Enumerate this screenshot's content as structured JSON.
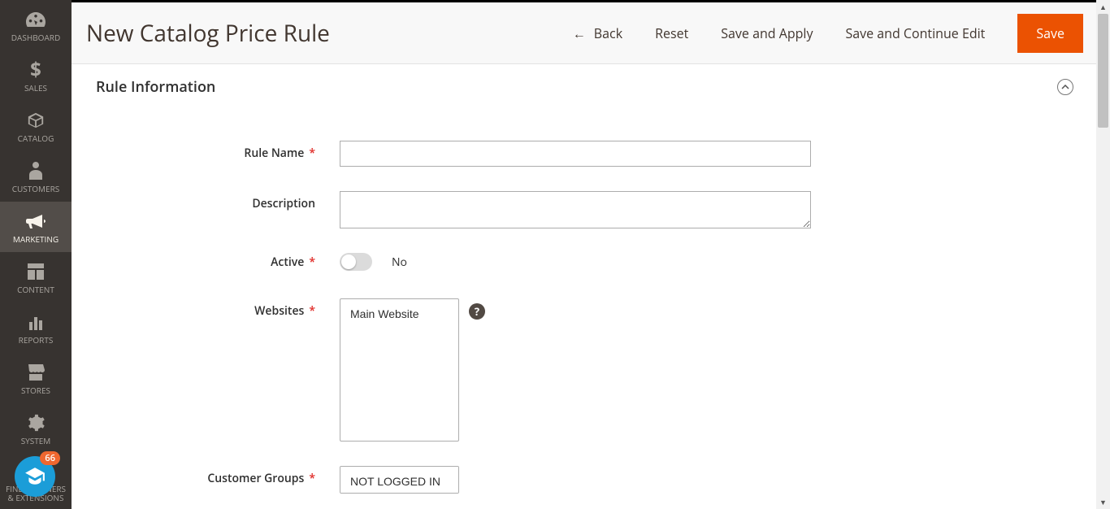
{
  "sidebar": {
    "items": [
      {
        "label": "DASHBOARD"
      },
      {
        "label": "SALES"
      },
      {
        "label": "CATALOG"
      },
      {
        "label": "CUSTOMERS"
      },
      {
        "label": "MARKETING"
      },
      {
        "label": "CONTENT"
      },
      {
        "label": "REPORTS"
      },
      {
        "label": "STORES"
      },
      {
        "label": "SYSTEM"
      },
      {
        "label": "FIND PARTNERS & EXTENSIONS"
      }
    ],
    "badge_count": "66"
  },
  "header": {
    "title": "New Catalog Price Rule",
    "back": "Back",
    "reset": "Reset",
    "save_apply": "Save and Apply",
    "save_continue": "Save and Continue Edit",
    "save": "Save"
  },
  "section": {
    "title": "Rule Information"
  },
  "form": {
    "rule_name": {
      "label": "Rule Name",
      "value": ""
    },
    "description": {
      "label": "Description",
      "value": ""
    },
    "active": {
      "label": "Active",
      "value_label": "No"
    },
    "websites": {
      "label": "Websites",
      "options": [
        "Main Website"
      ]
    },
    "customer_groups": {
      "label": "Customer Groups",
      "options": [
        "NOT LOGGED IN"
      ]
    }
  }
}
